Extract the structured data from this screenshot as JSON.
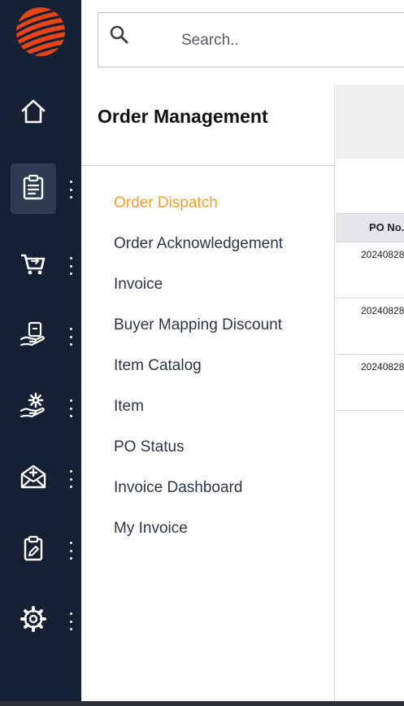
{
  "search": {
    "placeholder": "Search.."
  },
  "sidebar": {
    "items": [
      {
        "icon": "home-icon"
      },
      {
        "icon": "clipboard-list-icon",
        "active": true
      },
      {
        "icon": "cart-icon"
      },
      {
        "icon": "hand-invoice-icon"
      },
      {
        "icon": "hand-gear-icon"
      },
      {
        "icon": "envelope-plus-icon"
      },
      {
        "icon": "clipboard-edit-icon"
      },
      {
        "icon": "settings-gear-icon"
      }
    ]
  },
  "submenu": {
    "title": "Order Management",
    "items": [
      {
        "label": "Order Dispatch",
        "active": true
      },
      {
        "label": "Order Acknowledgement"
      },
      {
        "label": "Invoice"
      },
      {
        "label": "Buyer Mapping Discount"
      },
      {
        "label": "Item Catalog"
      },
      {
        "label": "Item"
      },
      {
        "label": "PO Status"
      },
      {
        "label": "Invoice Dashboard"
      },
      {
        "label": "My Invoice"
      }
    ]
  },
  "table": {
    "columns": [
      "PO No."
    ],
    "rows": [
      {
        "po_no": "20240828"
      },
      {
        "po_no": "20240828"
      },
      {
        "po_no": "20240828"
      }
    ]
  },
  "colors": {
    "rail_bg": "#152035",
    "active_menu": "#f0a030",
    "logo": "#e8441a"
  }
}
